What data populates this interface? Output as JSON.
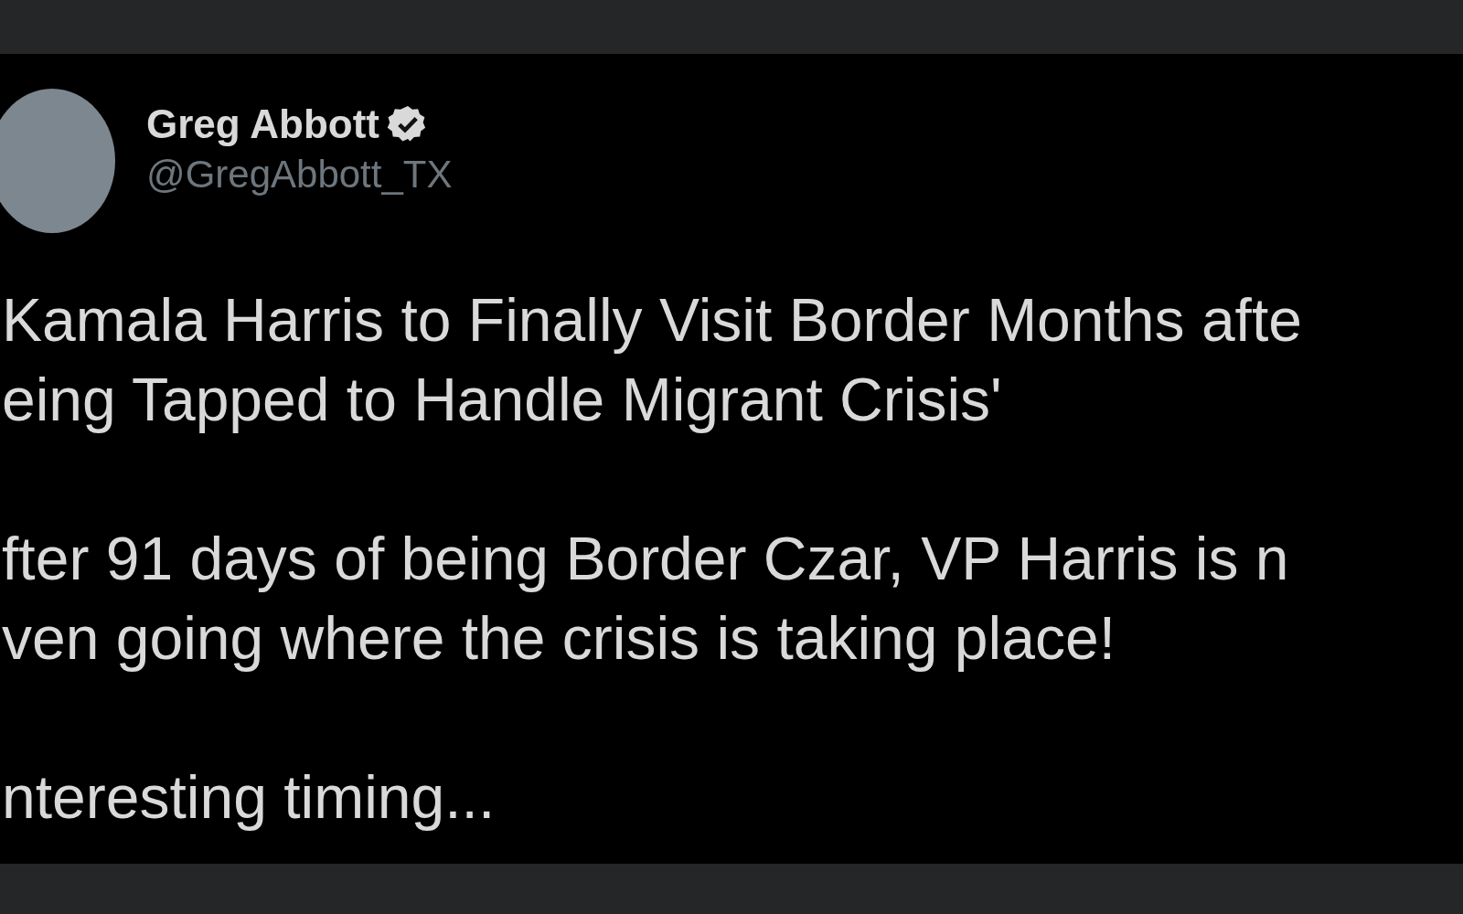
{
  "tweet": {
    "author": {
      "name": "Greg Abbott",
      "handle": "@GregAbbott_TX",
      "verified": true
    },
    "paragraphs": [
      [
        "Kamala Harris to Finally Visit Border Months afte",
        "eing Tapped to Handle Migrant Crisis'"
      ],
      [
        "fter 91 days of being Border Czar, VP Harris is n",
        "ven going where the crisis is taking place!"
      ],
      [
        "nteresting timing..."
      ]
    ]
  }
}
